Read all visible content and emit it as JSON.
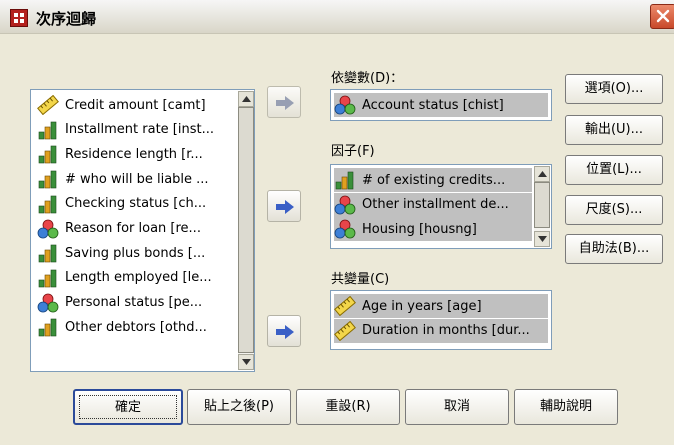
{
  "window": {
    "title": "次序迴歸"
  },
  "variable_list": {
    "items": [
      {
        "label": "Credit amount [camt]",
        "icon": "scale-icon"
      },
      {
        "label": "Installment rate [inst...",
        "icon": "ordinal-bars-icon"
      },
      {
        "label": "Residence length [r...",
        "icon": "ordinal-bars-icon"
      },
      {
        "label": "# who will be liable ...",
        "icon": "ordinal-bars-icon"
      },
      {
        "label": "Checking status [ch...",
        "icon": "ordinal-bars-icon"
      },
      {
        "label": "Reason for loan [re...",
        "icon": "nominal-icon"
      },
      {
        "label": "Saving plus bonds [...",
        "icon": "ordinal-bars-icon"
      },
      {
        "label": "Length employed [le...",
        "icon": "ordinal-bars-icon"
      },
      {
        "label": "Personal status [pe...",
        "icon": "nominal-icon"
      },
      {
        "label": "Other debtors [othd...",
        "icon": "ordinal-bars-icon"
      }
    ]
  },
  "dependent": {
    "label": "依變數(D)：",
    "item": {
      "label": "Account status [chist]",
      "icon": "nominal-icon"
    }
  },
  "factors": {
    "label": "因子(F)",
    "items": [
      {
        "label": "# of existing credits...",
        "icon": "ordinal-bars-icon"
      },
      {
        "label": "Other installment de...",
        "icon": "nominal-icon"
      },
      {
        "label": "Housing [housng]",
        "icon": "nominal-icon"
      }
    ]
  },
  "covariates": {
    "label": "共變量(C)",
    "items": [
      {
        "label": "Age in years [age]",
        "icon": "scale-icon"
      },
      {
        "label": "Duration in months [dur...",
        "icon": "scale-icon"
      }
    ]
  },
  "side_buttons": {
    "options": "選項(O)...",
    "output": "輸出(U)...",
    "location": "位置(L)...",
    "scale": "尺度(S)...",
    "bootstrap": "自助法(B)..."
  },
  "bottom_buttons": {
    "ok": "確定",
    "paste": "貼上之後(P)",
    "reset": "重設(R)",
    "cancel": "取消",
    "help": "輔助說明"
  },
  "colors": {
    "dialog_bg": "#ece9d8",
    "list_border": "#7f9db9",
    "arrow_blue": "#3a5fc6",
    "selected_bg": "#c0c0c0"
  }
}
